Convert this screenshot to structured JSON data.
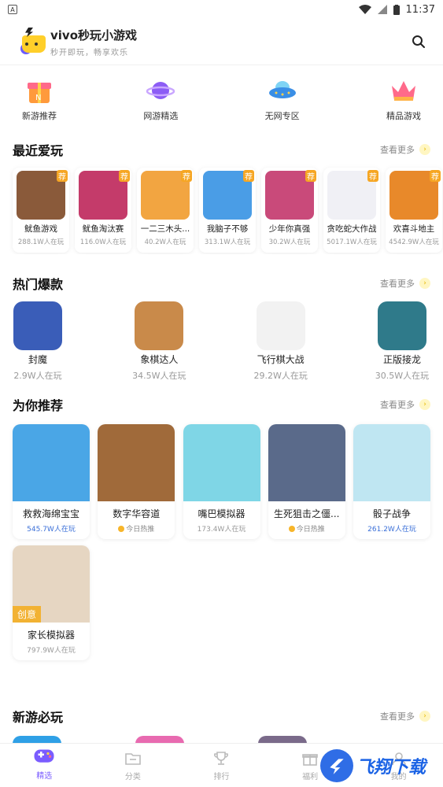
{
  "status": {
    "time": "11:37",
    "left_icon": "A"
  },
  "header": {
    "title": "vivo秒玩小游戏",
    "subtitle": "秒开即玩，畅享欢乐"
  },
  "quick": [
    {
      "label": "新游推荐",
      "icon": "gift-box-icon"
    },
    {
      "label": "网游精选",
      "icon": "planet-icon"
    },
    {
      "label": "无网专区",
      "icon": "ufo-icon"
    },
    {
      "label": "精品游戏",
      "icon": "crown-icon"
    }
  ],
  "sections": {
    "recent": "最近爱玩",
    "hot": "热门爆款",
    "rec": "为你推荐",
    "new": "新游必玩",
    "more": "查看更多"
  },
  "recent": [
    {
      "name": "鱿鱼游戏",
      "count": "288.1W人在玩",
      "badge": "荐",
      "color": "#8a5a3a"
    },
    {
      "name": "鱿鱼淘汰赛",
      "count": "116.0W人在玩",
      "badge": "荐",
      "color": "#c43b6a"
    },
    {
      "name": "一二三木头...",
      "count": "40.2W人在玩",
      "badge": "荐",
      "color": "#f2a541"
    },
    {
      "name": "我脑子不够",
      "count": "313.1W人在玩",
      "badge": "荐",
      "color": "#4a9de6"
    },
    {
      "name": "少年你真强",
      "count": "30.2W人在玩",
      "badge": "荐",
      "color": "#c94a7a"
    },
    {
      "name": "贪吃蛇大作战",
      "count": "5017.1W人在玩",
      "badge": "荐",
      "color": "#f0f0f5"
    },
    {
      "name": "欢喜斗地主",
      "count": "4542.9W人在玩",
      "badge": "荐",
      "color": "#e8892a"
    }
  ],
  "hot": [
    {
      "name": "封魔",
      "count": "2.9W人在玩",
      "color": "#3a5db8"
    },
    {
      "name": "象棋达人",
      "count": "34.5W人在玩",
      "color": "#c98a4a"
    },
    {
      "name": "飞行棋大战",
      "count": "29.2W人在玩",
      "color": "#f2f2f2"
    },
    {
      "name": "正版接龙",
      "count": "30.5W人在玩",
      "color": "#2f7a8a"
    }
  ],
  "rec": [
    {
      "name": "救救海绵宝宝",
      "count": "545.7W人在玩",
      "style": "blue",
      "color": "#4aa6e6"
    },
    {
      "name": "数字华容道",
      "count": "今日热推",
      "style": "hot",
      "color": "#a06a3a"
    },
    {
      "name": "嘴巴模拟器",
      "count": "173.4W人在玩",
      "style": "normal",
      "color": "#7fd6e6"
    },
    {
      "name": "生死狙击之僵...",
      "count": "今日热推",
      "style": "hot",
      "color": "#5a6a8a"
    },
    {
      "name": "骰子战争",
      "count": "261.2W人在玩",
      "style": "blue",
      "color": "#bfe6f2"
    },
    {
      "name": "家长模拟器",
      "count": "797.9W人在玩",
      "style": "normal",
      "color": "#e6d6c2",
      "tag": "创意"
    }
  ],
  "tabs": [
    {
      "label": "精选",
      "active": true
    },
    {
      "label": "分类",
      "active": false
    },
    {
      "label": "排行",
      "active": false
    },
    {
      "label": "福利",
      "active": false
    },
    {
      "label": "我的",
      "active": false
    }
  ],
  "watermark": "飞翔下载"
}
